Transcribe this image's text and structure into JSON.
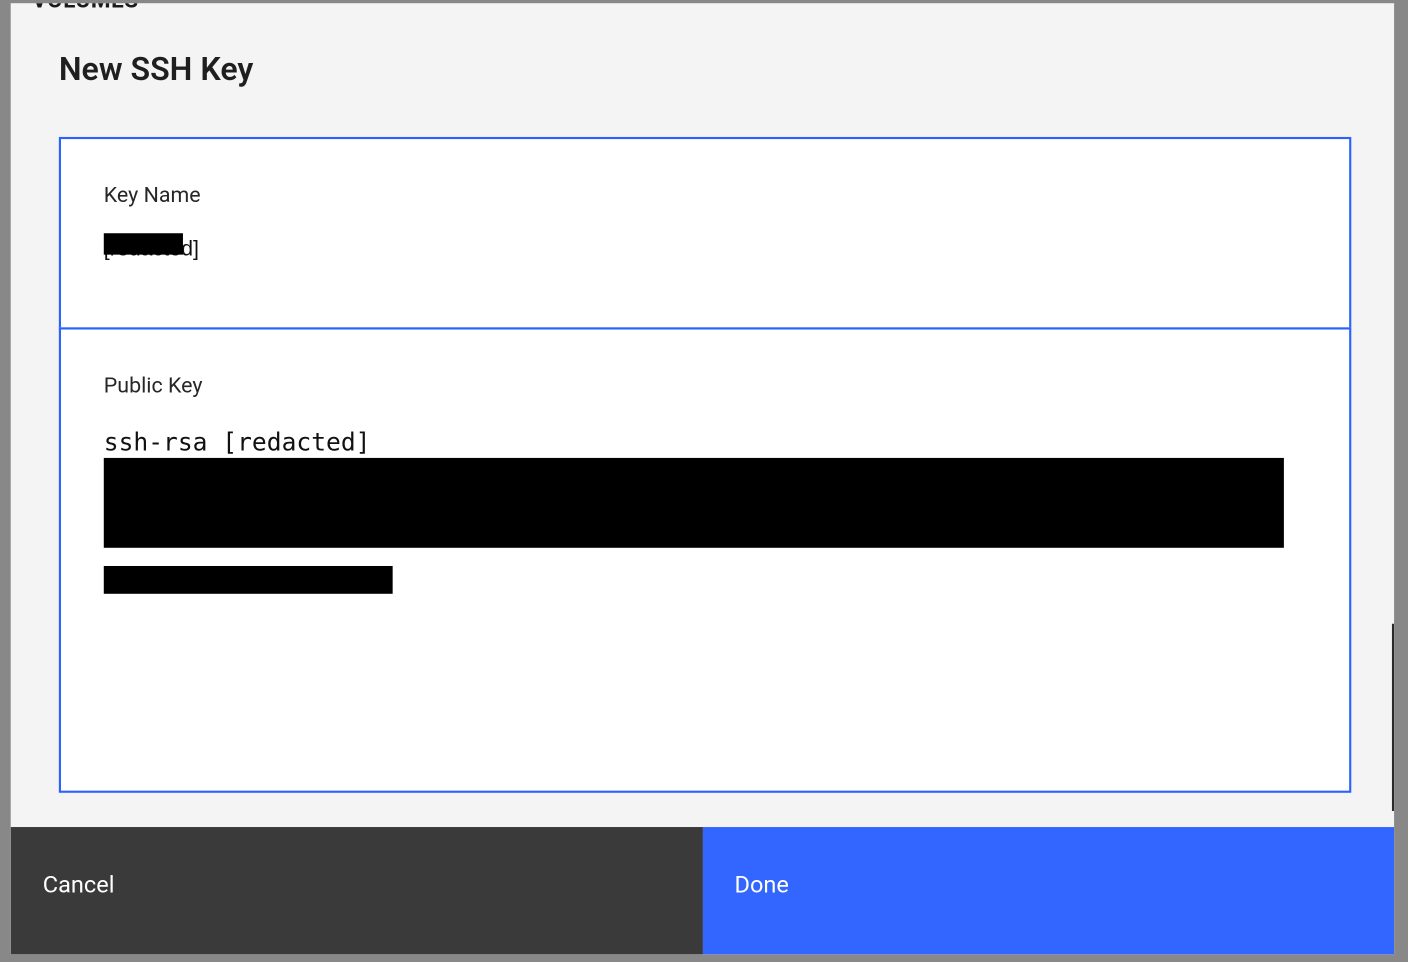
{
  "background": {
    "hidden_title": "Volumes"
  },
  "dialog": {
    "title": "New SSH Key",
    "fields": {
      "key_name": {
        "label": "Key Name",
        "value": "[redacted]"
      },
      "public_key": {
        "label": "Public Key",
        "value": "ssh-rsa [redacted]"
      }
    },
    "actions": {
      "cancel_label": "Cancel",
      "done_label": "Done"
    }
  },
  "colors": {
    "accent": "#2962FF",
    "cancel_bg": "#3A3A3A",
    "done_bg": "#3366FF",
    "panel_bg": "#F4F4F4"
  }
}
